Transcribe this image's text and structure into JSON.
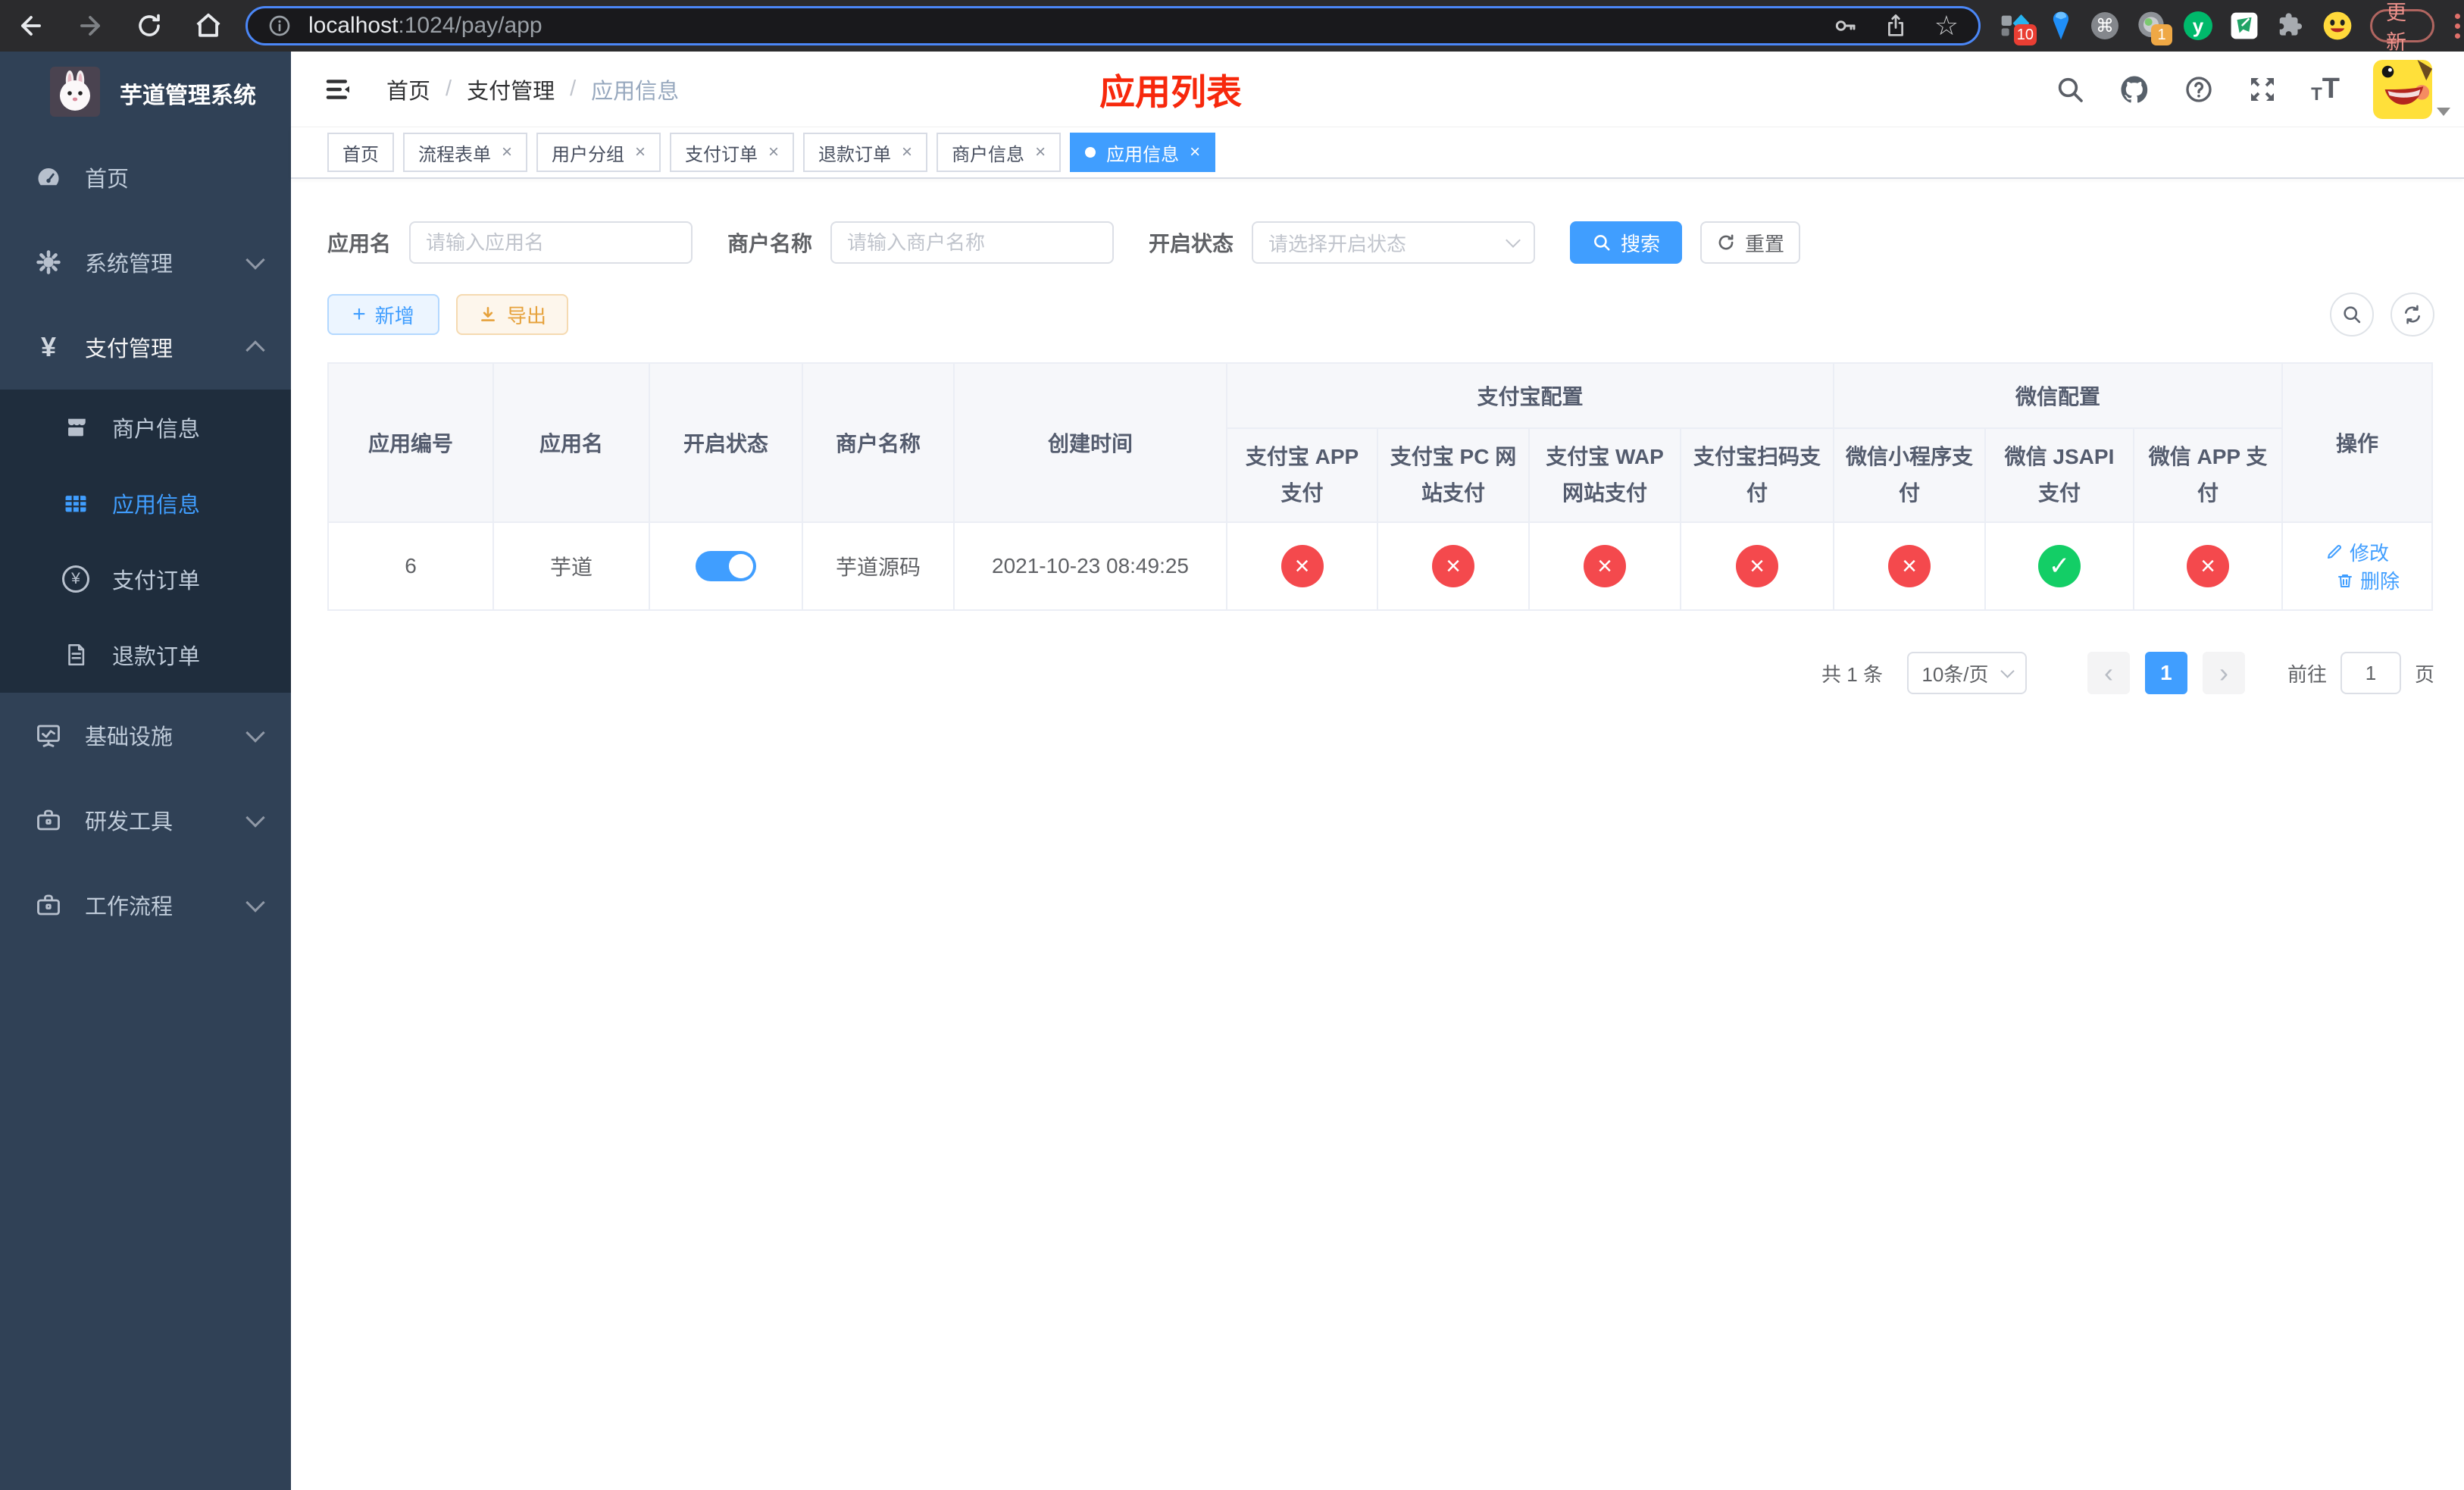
{
  "browser": {
    "url_host": "localhost",
    "url_path": ":1024/pay/app",
    "update_label": "更新",
    "ext_badge_ten": "10",
    "ext_badge_one": "1"
  },
  "sidebar": {
    "title": "芋道管理系统",
    "items": {
      "home": "首页",
      "system": "系统管理",
      "pay": "支付管理",
      "infra": "基础设施",
      "dev": "研发工具",
      "workflow": "工作流程"
    },
    "submenu": {
      "merchant": "商户信息",
      "app": "应用信息",
      "order": "支付订单",
      "refund": "退款订单"
    }
  },
  "navbar": {
    "breadcrumb": {
      "home": "首页",
      "pay": "支付管理",
      "app": "应用信息"
    },
    "page_title": "应用列表"
  },
  "tabs": [
    {
      "label": "首页",
      "closable": false,
      "active": false
    },
    {
      "label": "流程表单",
      "closable": true,
      "active": false
    },
    {
      "label": "用户分组",
      "closable": true,
      "active": false
    },
    {
      "label": "支付订单",
      "closable": true,
      "active": false
    },
    {
      "label": "退款订单",
      "closable": true,
      "active": false
    },
    {
      "label": "商户信息",
      "closable": true,
      "active": false
    },
    {
      "label": "应用信息",
      "closable": true,
      "active": true
    }
  ],
  "filter": {
    "app_name_label": "应用名",
    "app_name_placeholder": "请输入应用名",
    "merchant_label": "商户名称",
    "merchant_placeholder": "请输入商户名称",
    "status_label": "开启状态",
    "status_placeholder": "请选择开启状态",
    "search_label": "搜索",
    "reset_label": "重置"
  },
  "toolbar": {
    "add_label": "新增",
    "export_label": "导出"
  },
  "table": {
    "headers": {
      "app_id": "应用编号",
      "app_name": "应用名",
      "status": "开启状态",
      "merchant": "商户名称",
      "create_time": "创建时间",
      "alipay_group": "支付宝配置",
      "wechat_group": "微信配置",
      "actions": "操作"
    },
    "sub_headers": {
      "alipay_app": "支付宝 APP 支付",
      "alipay_pc": "支付宝 PC 网站支付",
      "alipay_wap": "支付宝 WAP 网站支付",
      "alipay_qr": "支付宝扫码支付",
      "wechat_lite": "微信小程序支付",
      "wechat_jsapi": "微信 JSAPI 支付",
      "wechat_app": "微信 APP 支付"
    },
    "row": {
      "app_id": "6",
      "app_name": "芋道",
      "status_enabled": true,
      "merchant": "芋道源码",
      "create_time": "2021-10-23 08:49:25",
      "alipay_app": false,
      "alipay_pc": false,
      "alipay_wap": false,
      "alipay_qr": false,
      "wechat_lite": false,
      "wechat_jsapi": true,
      "wechat_app": false
    },
    "actions": {
      "edit": "修改",
      "delete": "删除"
    }
  },
  "pagination": {
    "total": "共 1 条",
    "page_size": "10条/页",
    "prev": "‹",
    "page": "1",
    "next": "›",
    "goto_label": "前往",
    "goto_value": "1",
    "page_unit": "页"
  },
  "icons": {
    "check": "✓",
    "cross": "×",
    "close": "×",
    "star": "☆",
    "cmd": "⌘",
    "plus": "+",
    "yen": "¥",
    "yuque_letter": "y",
    "font_small": "T",
    "font_big": "T",
    "help_mark": "?"
  },
  "colors": {
    "accent_blue": "#409eff",
    "title_red": "#f7280c",
    "success_green": "#13ce66",
    "danger_red": "#f4494d",
    "warning_orange": "#e6a23c",
    "sidebar_bg": "#304156",
    "sidebar_submenu_bg": "#1f2d3d"
  }
}
